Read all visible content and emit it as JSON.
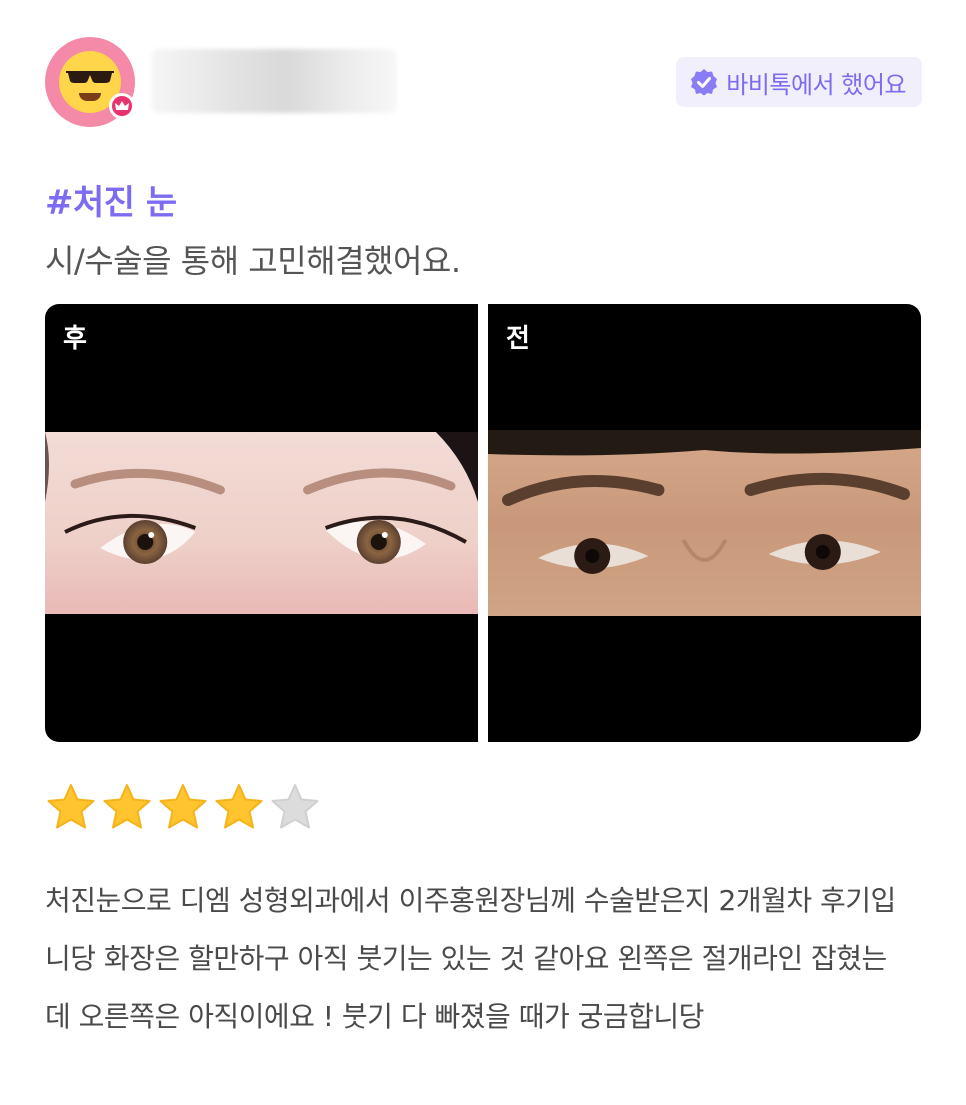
{
  "colors": {
    "accent": "#7b6cf2",
    "badge_bg": "#f1effc",
    "star_filled": "#ffc42e",
    "star_empty": "#dcdcdc",
    "avatar_bg": "#f48aa8"
  },
  "user": {
    "avatar_icon": "sunglasses-emoji-avatar",
    "badge_icon": "crown-badge-icon"
  },
  "verified": {
    "icon": "verified-check-icon",
    "label": "바비톡에서 했어요"
  },
  "post": {
    "hashtag": "#처진 눈",
    "resolved_text": "시/수술을 통해 고민해결했어요.",
    "photos": [
      {
        "label": "후"
      },
      {
        "label": "전"
      }
    ],
    "rating": 4,
    "rating_max": 5,
    "review": "처진눈으로 디엠 성형외과에서 이주홍원장님께 수술받은지 2개월차 후기입니당 화장은 할만하구 아직 붓기는 있는 것 같아요 왼쪽은 절개라인 잡혔는데 오른쪽은 아직이에요 ! 붓기 다 빠졌을 때가 궁금합니당"
  }
}
